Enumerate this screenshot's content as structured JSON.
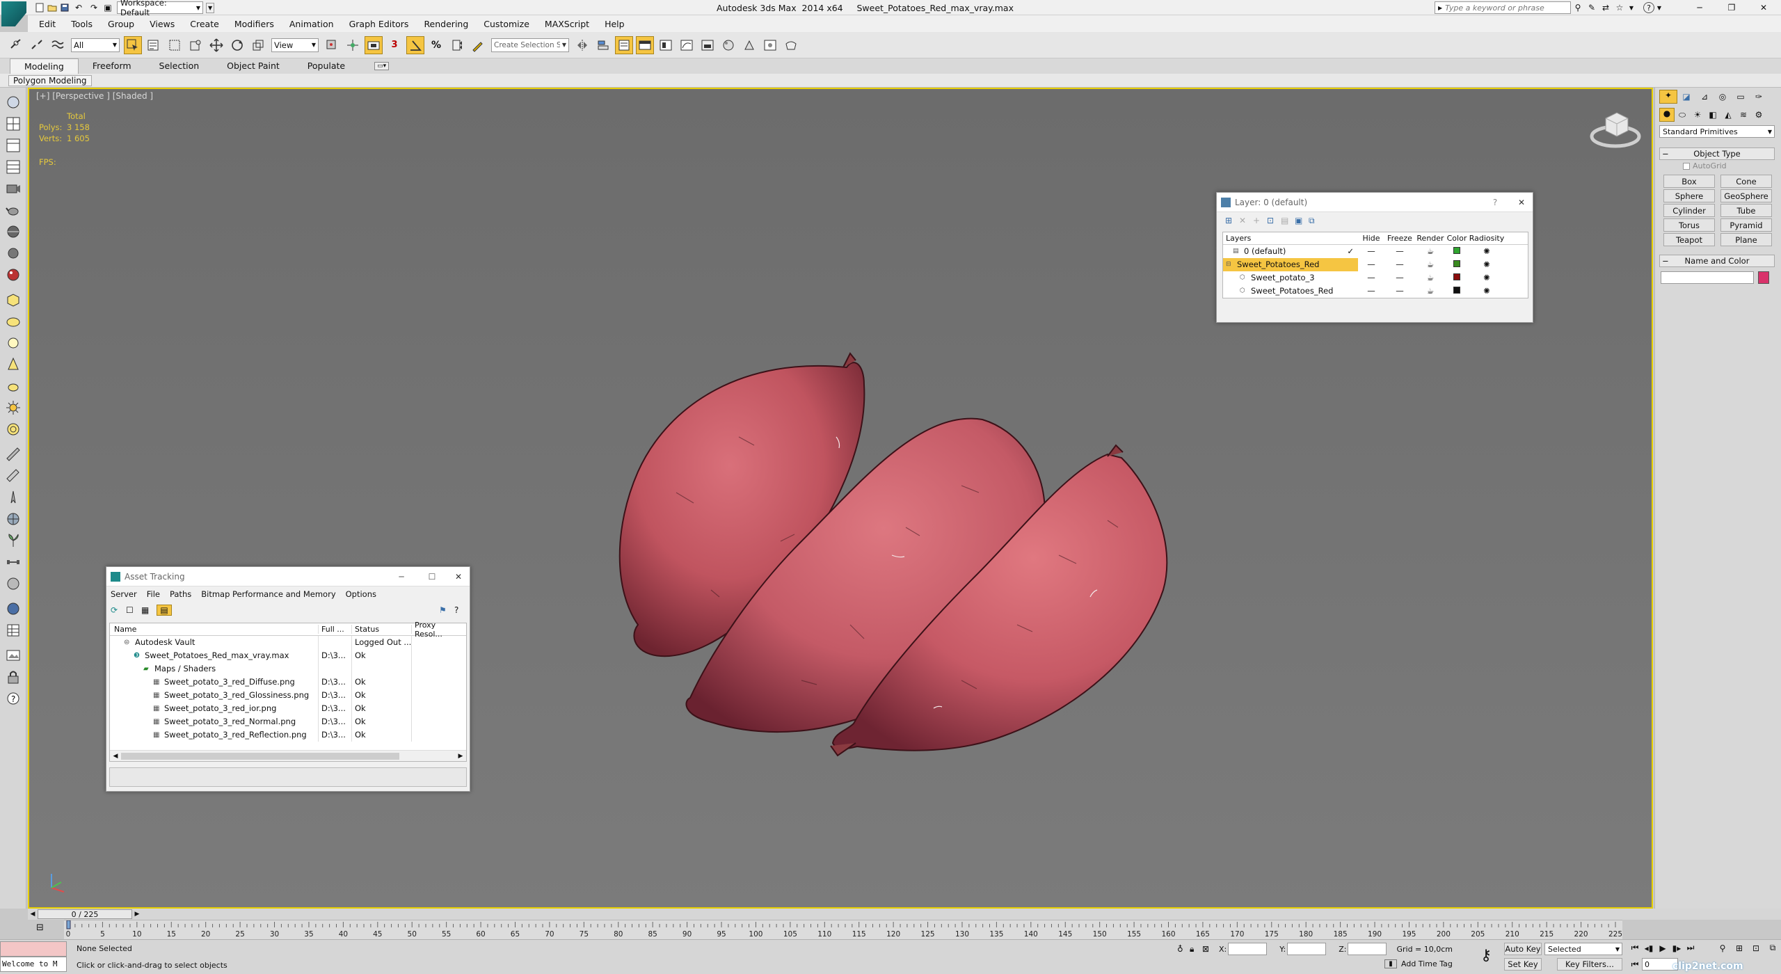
{
  "titlebar": {
    "workspace": "Workspace: Default",
    "title": "Autodesk 3ds Max  2014 x64     Sweet_Potatoes_Red_max_vray.max",
    "search_placeholder": "Type a keyword or phrase"
  },
  "menu": [
    "Edit",
    "Tools",
    "Group",
    "Views",
    "Create",
    "Modifiers",
    "Animation",
    "Graph Editors",
    "Rendering",
    "Customize",
    "MAXScript",
    "Help"
  ],
  "toolbar": {
    "filter_value": "All",
    "view_value": "View",
    "selection_set_placeholder": "Create Selection Se"
  },
  "ribbon": {
    "tabs": [
      "Modeling",
      "Freeform",
      "Selection",
      "Object Paint",
      "Populate"
    ],
    "sub": "Polygon Modeling"
  },
  "viewport": {
    "label": "[+] [Perspective ] [Shaded ]",
    "stats_header": "Total",
    "polys_label": "Polys:",
    "polys_value": "3 158",
    "verts_label": "Verts:",
    "verts_value": "1 605",
    "fps_label": "FPS:"
  },
  "layer_dialog": {
    "title": "Layer: 0 (default)",
    "help": "?",
    "columns": [
      "Layers",
      "Hide",
      "Freeze",
      "Render",
      "Color",
      "Radiosity"
    ],
    "rows": [
      {
        "name": "0 (default)",
        "color": "#2fa52f",
        "current": true,
        "indent": 1
      },
      {
        "name": "Sweet_Potatoes_Red",
        "color": "#3a8a1f",
        "selected": true,
        "indent": 0
      },
      {
        "name": "Sweet_potato_3",
        "color": "#8a0c0c",
        "indent": 2
      },
      {
        "name": "Sweet_Potatoes_Red",
        "color": "#111111",
        "indent": 2
      }
    ]
  },
  "asset_tracking": {
    "title": "Asset Tracking",
    "menus": [
      "Server",
      "File",
      "Paths",
      "Bitmap Performance and Memory",
      "Options"
    ],
    "columns": [
      "Name",
      "Full ...",
      "Status",
      "Proxy Resol..."
    ],
    "rows": [
      {
        "name": "Autodesk Vault",
        "path": "",
        "status": "Logged Out ...",
        "indent": 1
      },
      {
        "name": "Sweet_Potatoes_Red_max_vray.max",
        "path": "D:\\3...",
        "status": "Ok",
        "indent": 2
      },
      {
        "name": "Maps / Shaders",
        "path": "",
        "status": "",
        "indent": 3
      },
      {
        "name": "Sweet_potato_3_red_Diffuse.png",
        "path": "D:\\3...",
        "status": "Ok",
        "indent": 4
      },
      {
        "name": "Sweet_potato_3_red_Glossiness.png",
        "path": "D:\\3...",
        "status": "Ok",
        "indent": 4
      },
      {
        "name": "Sweet_potato_3_red_ior.png",
        "path": "D:\\3...",
        "status": "Ok",
        "indent": 4
      },
      {
        "name": "Sweet_potato_3_red_Normal.png",
        "path": "D:\\3...",
        "status": "Ok",
        "indent": 4
      },
      {
        "name": "Sweet_potato_3_red_Reflection.png",
        "path": "D:\\3...",
        "status": "Ok",
        "indent": 4
      }
    ]
  },
  "command_panel": {
    "dropdown": "Standard Primitives",
    "object_type": "Object Type",
    "autogrid": "AutoGrid",
    "buttons": [
      "Box",
      "Cone",
      "Sphere",
      "GeoSphere",
      "Cylinder",
      "Tube",
      "Torus",
      "Pyramid",
      "Teapot",
      "Plane"
    ],
    "name_and_color": "Name and Color",
    "object_color": "#d9336b"
  },
  "timeline": {
    "frame": "0 / 225",
    "ticks": [
      "0",
      "5",
      "10",
      "15",
      "20",
      "25",
      "30",
      "35",
      "40",
      "45",
      "50",
      "55",
      "60",
      "65",
      "70",
      "75",
      "80",
      "85",
      "90",
      "95",
      "100",
      "105",
      "110",
      "115",
      "120",
      "125",
      "130",
      "135",
      "140",
      "145",
      "150",
      "155",
      "160",
      "165",
      "170",
      "175",
      "180",
      "185",
      "190",
      "195",
      "200",
      "205",
      "210",
      "215",
      "220",
      "225"
    ]
  },
  "status": {
    "welcome": "Welcome to M",
    "selection": "None Selected",
    "prompt": "Click or click-and-drag to select objects",
    "x_label": "X:",
    "y_label": "Y:",
    "z_label": "Z:",
    "grid": "Grid = 10,0cm",
    "add_time_tag": "Add Time Tag",
    "auto_key": "Auto Key",
    "set_key": "Set Key",
    "selected": "Selected",
    "key_filters": "Key Filters...",
    "frame_value": "0",
    "watermark": "clip2net.com"
  }
}
